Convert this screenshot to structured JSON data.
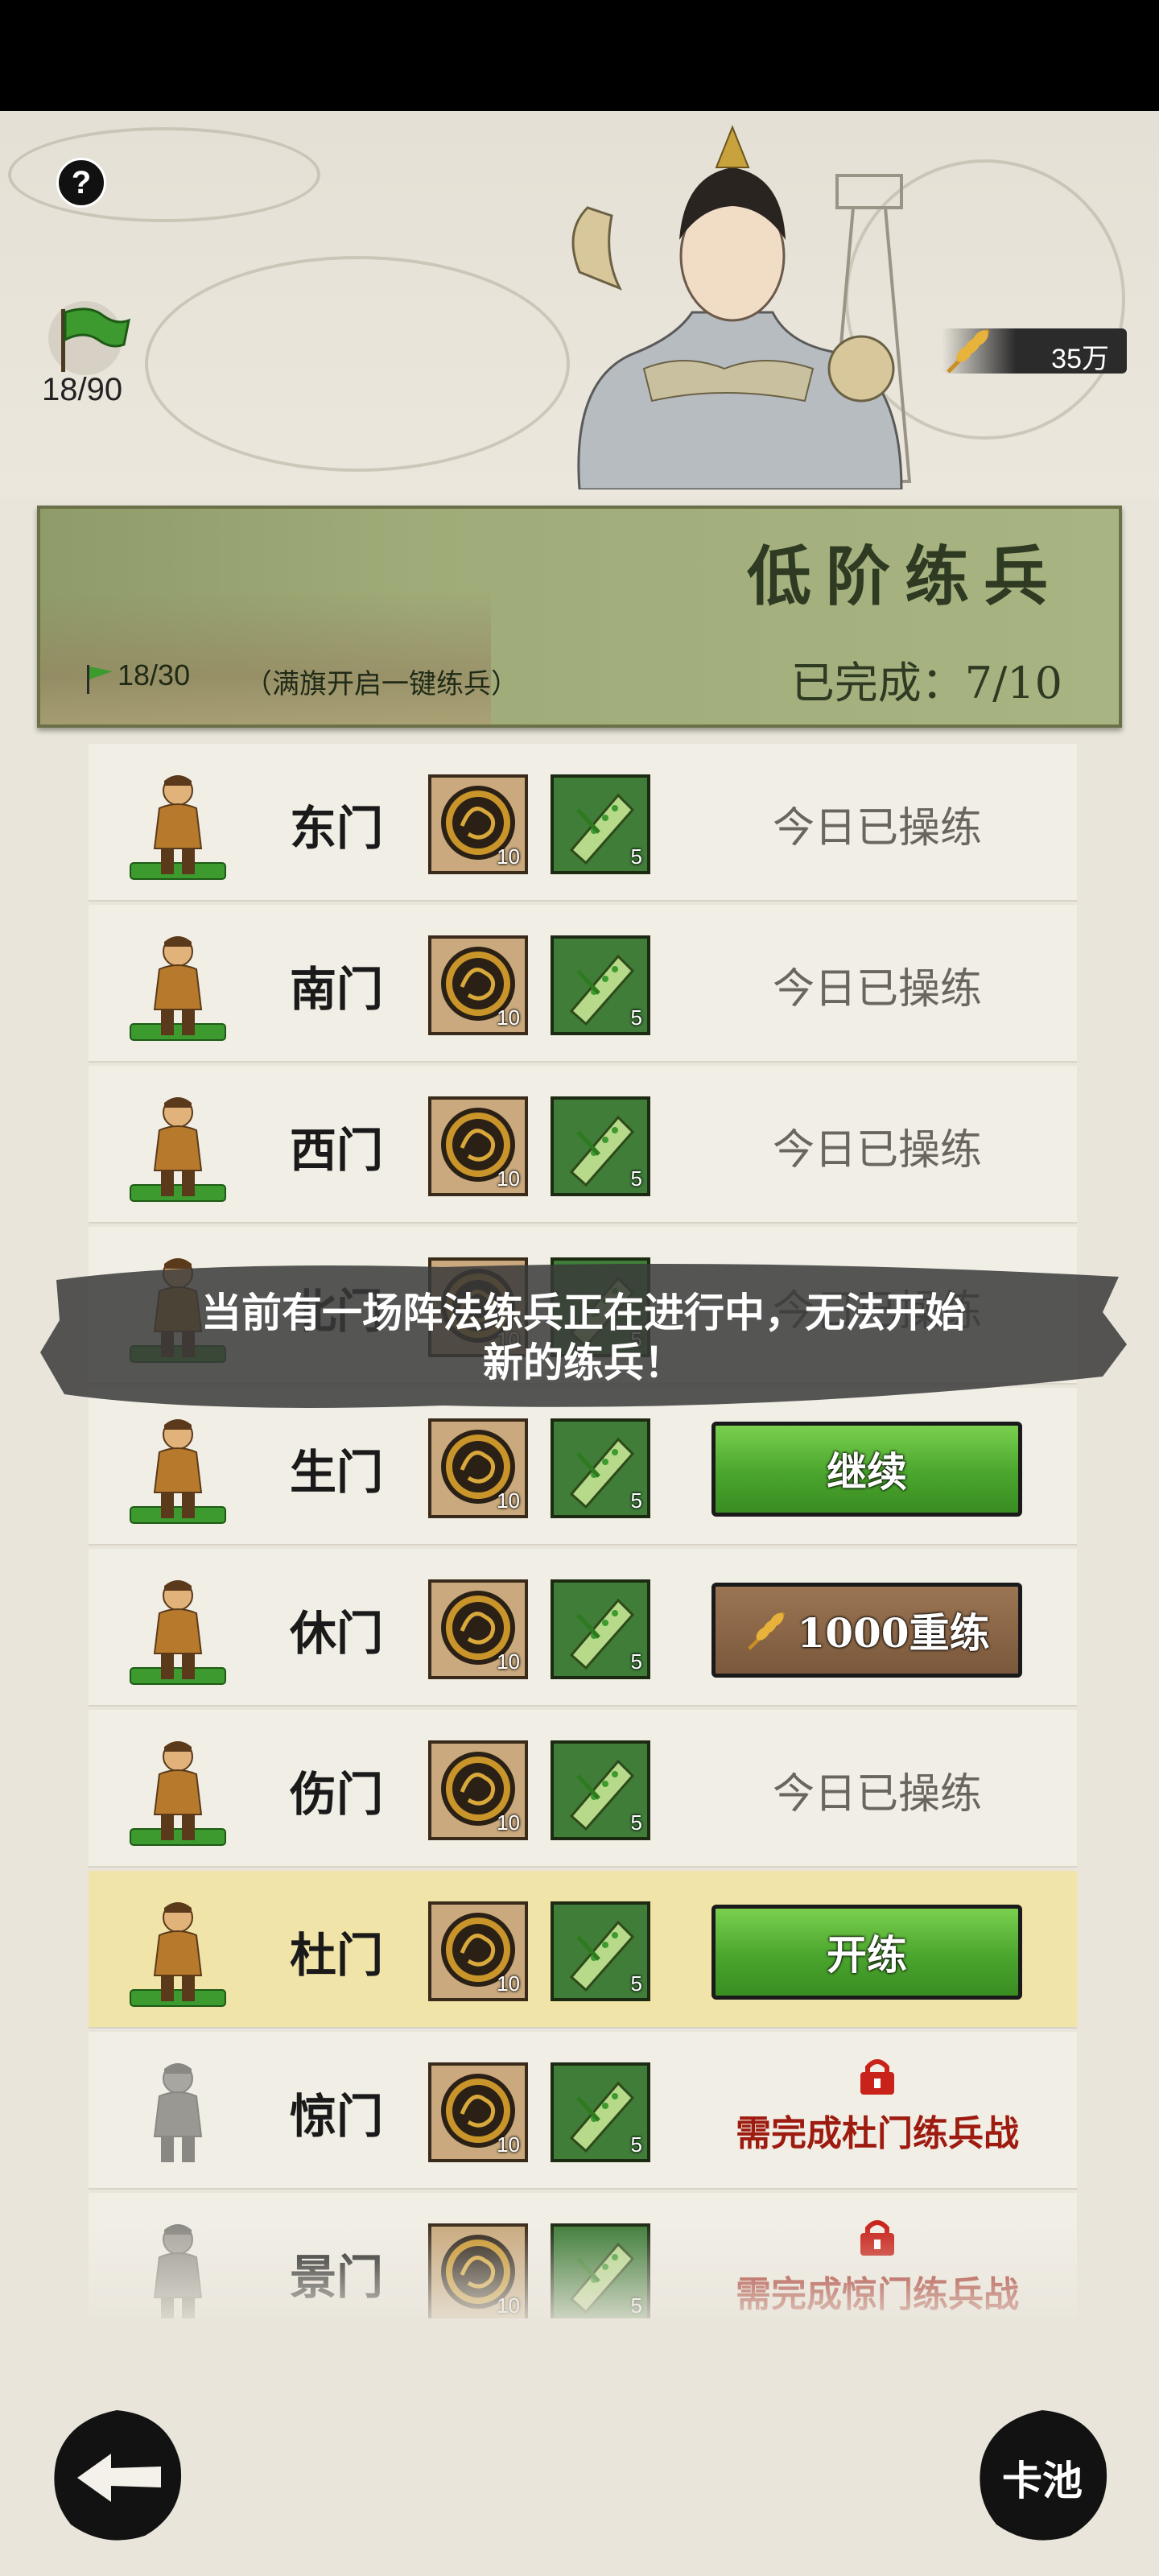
{
  "header": {
    "help_label": "?",
    "flag_count": "18/90",
    "grain_amount": "35万"
  },
  "banner": {
    "title": "低阶练兵",
    "progress": "18/30",
    "hint": "（满旗开启一键练兵）",
    "completed": "已完成：7/10"
  },
  "rows": [
    {
      "name": "东门",
      "coin_count": "10",
      "scroll_count": "5",
      "status": "今日已操练",
      "state": "done"
    },
    {
      "name": "南门",
      "coin_count": "10",
      "scroll_count": "5",
      "status": "今日已操练",
      "state": "done"
    },
    {
      "name": "西门",
      "coin_count": "10",
      "scroll_count": "5",
      "status": "今日已操练",
      "state": "done"
    },
    {
      "name": "北门",
      "coin_count": "10",
      "scroll_count": "5",
      "status": "今日已操练",
      "state": "done"
    },
    {
      "name": "生门",
      "coin_count": "10",
      "scroll_count": "5",
      "button": "继续",
      "state": "continue"
    },
    {
      "name": "休门",
      "coin_count": "10",
      "scroll_count": "5",
      "button": "1000重练",
      "state": "retrain"
    },
    {
      "name": "伤门",
      "coin_count": "10",
      "scroll_count": "5",
      "status": "今日已操练",
      "state": "done"
    },
    {
      "name": "杜门",
      "coin_count": "10",
      "scroll_count": "5",
      "button": "开练",
      "state": "start"
    },
    {
      "name": "惊门",
      "coin_count": "10",
      "scroll_count": "5",
      "lock_text": "需完成杜门练兵战",
      "state": "locked"
    },
    {
      "name": "景门",
      "coin_count": "10",
      "scroll_count": "5",
      "lock_text": "需完成惊门练兵战",
      "state": "locked"
    }
  ],
  "toast": {
    "line1": "当前有一场阵法练兵正在进行中，无法开始",
    "line2": "新的练兵！"
  },
  "footer": {
    "card_pool_label": "卡池"
  },
  "colors": {
    "banner_green": "#9fab78",
    "button_green": "#4aa52d",
    "button_brown": "#7b583c",
    "lock_red": "#9e1b10",
    "highlight_row": "#f1e4a8"
  },
  "icons": [
    "help-icon",
    "flag-icon",
    "grain-icon",
    "coin-icon",
    "scroll-icon",
    "lock-icon",
    "back-arrow-icon"
  ]
}
